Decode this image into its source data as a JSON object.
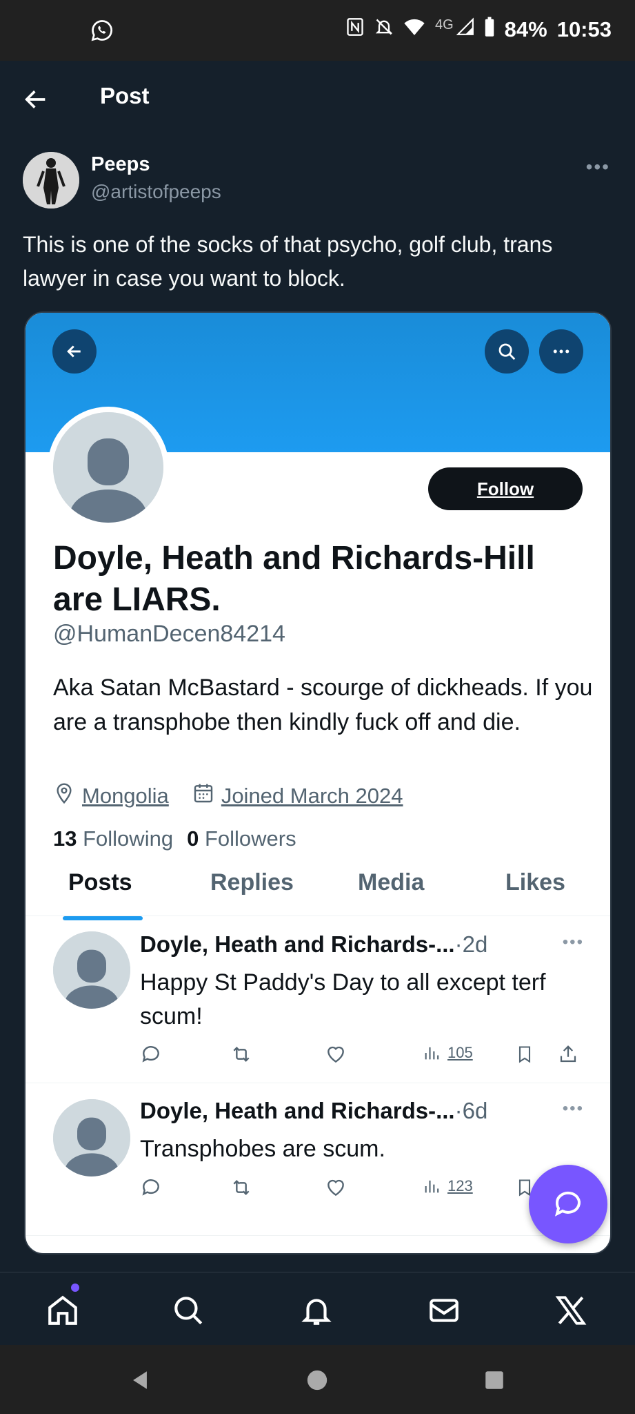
{
  "status_bar": {
    "network": "4G",
    "battery": "84%",
    "time": "10:53",
    "icons": [
      "whatsapp-icon",
      "nfc-icon",
      "mute-icon",
      "wifi-icon",
      "signal-icon",
      "battery-icon"
    ]
  },
  "header": {
    "title": "Post"
  },
  "post": {
    "author_name": "Peeps",
    "author_handle": "@artistofpeeps",
    "text": "This is one of the socks of that psycho, golf club, trans lawyer in case you want to block."
  },
  "embedded_profile": {
    "follow_label": "Follow",
    "display_name": "Doyle, Heath and Richards-Hill are LIARS.",
    "handle": "@HumanDecen84214",
    "bio": "Aka Satan McBastard - scourge of dickheads. If you are a transphobe then kindly fuck off and die.",
    "location": "Mongolia",
    "joined": "Joined March 2024",
    "following_count": "13",
    "following_label": "Following",
    "followers_count": "0",
    "followers_label": "Followers",
    "tabs": [
      "Posts",
      "Replies",
      "Media",
      "Likes"
    ],
    "active_tab": "Posts",
    "tweets": [
      {
        "name": "Doyle, Heath and Richards-...",
        "time": "·2d",
        "text": "Happy St Paddy's Day to all except terf scum!",
        "views": "105"
      },
      {
        "name": "Doyle, Heath and Richards-...",
        "time": "·6d",
        "text": "Transphobes are scum.",
        "views": "123"
      }
    ]
  },
  "colors": {
    "background": "#15202b",
    "banner": "#1d9bf0",
    "accent": "#1d9bf0",
    "fab": "#7856ff"
  },
  "bottom_nav": [
    "home-icon",
    "search-icon",
    "notifications-icon",
    "messages-icon",
    "x-logo-icon"
  ]
}
